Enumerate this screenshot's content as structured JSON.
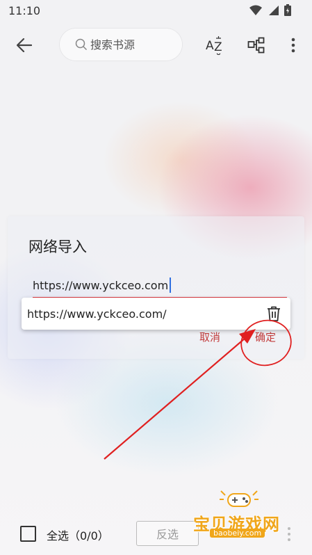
{
  "status": {
    "time": "11:10"
  },
  "toolbar": {
    "search_placeholder": "搜索书源",
    "sort_label": "AZ"
  },
  "dialog": {
    "title": "网络导入",
    "url_value": "https://www.yckceo.com",
    "suggestion": "https://www.yckceo.com/",
    "cancel_label": "取消",
    "confirm_label": "确定"
  },
  "bottom": {
    "select_all_label": "全选（0/0）",
    "invert_label": "反选"
  },
  "watermark": {
    "text": "宝贝游戏网",
    "url": "baobeiy.com"
  },
  "colors": {
    "accent": "#d9363e",
    "caret": "#2f6fe0",
    "watermark": "#f0a61a"
  }
}
